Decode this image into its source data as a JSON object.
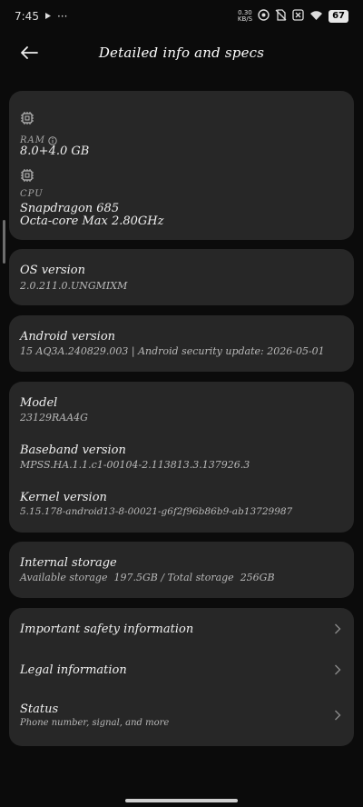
{
  "status_bar": {
    "time": "7:45",
    "speed_top": "0.30",
    "speed_bottom": "KB/S",
    "battery": "67"
  },
  "header": {
    "title": "Detailed info and specs"
  },
  "ram": {
    "label": "RAM",
    "value": "8.0+4.0 GB"
  },
  "cpu": {
    "label": "CPU",
    "name": "Snapdragon 685",
    "cores": "Octa-core Max 2.80GHz"
  },
  "os": {
    "label": "OS version",
    "value": "2.0.211.0.UNGMIXM"
  },
  "android": {
    "label": "Android version",
    "value": "15 AQ3A.240829.003 | Android security update: 2026-05-01"
  },
  "model": {
    "label": "Model",
    "value": "23129RAA4G"
  },
  "baseband": {
    "label": "Baseband version",
    "value": "MPSS.HA.1.1.c1-00104-2.113813.3.137926.3"
  },
  "kernel": {
    "label": "Kernel version",
    "value": "5.15.178-android13-8-00021-g6f2f96b86b9-ab13729987"
  },
  "storage": {
    "label": "Internal storage",
    "value": "Available storage  197.5GB / Total storage  256GB"
  },
  "links": {
    "safety": "Important safety information",
    "legal": "Legal information",
    "status": "Status",
    "status_sub": "Phone number, signal, and more"
  }
}
